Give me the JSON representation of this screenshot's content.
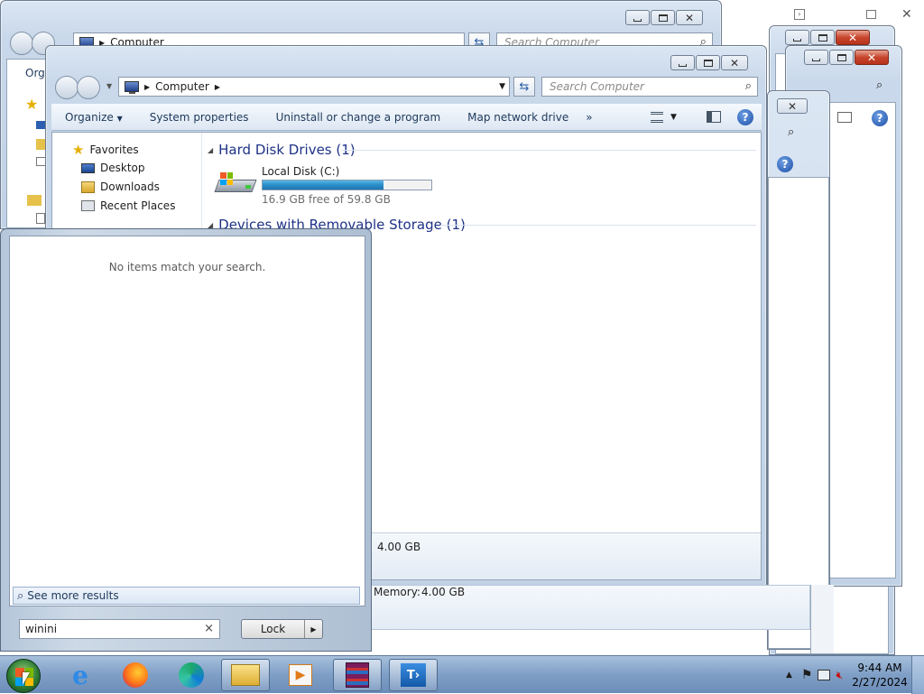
{
  "colors": {
    "accent": "#1e3287",
    "drive_fill": "#2b8dc8",
    "close_red": "#c7452c"
  },
  "back_window_1": {
    "address_text": "Computer",
    "search_placeholder": "Search Computer",
    "toolbar_partial": "Orga"
  },
  "explorer": {
    "address": {
      "location": "Computer"
    },
    "search_placeholder": "Search Computer",
    "toolbar": {
      "organize": "Organize",
      "system_properties": "System properties",
      "uninstall": "Uninstall or change a program",
      "map_drive": "Map network drive",
      "more": "»"
    },
    "nav": {
      "favorites": "Favorites",
      "desktop": "Desktop",
      "downloads": "Downloads",
      "recent_places": "Recent Places"
    },
    "groups": {
      "hard_disk": "Hard Disk Drives (1)",
      "removable": "Devices with Removable Storage (1)"
    },
    "drive": {
      "name": "Local Disk (C:)",
      "free_text": "16.9 GB free of 59.8 GB",
      "used_fraction": 0.717
    },
    "details_memory": "4.00 GB"
  },
  "back_details": {
    "memory_label": "Memory:",
    "memory_value": "4.00 GB"
  },
  "start_menu": {
    "no_items": "No items match your search.",
    "see_more": "See more results",
    "search_value": "winini",
    "lock_label": "Lock"
  },
  "taskbar": {
    "items": [
      "internet-explorer",
      "firefox",
      "edge",
      "explorer",
      "media-player",
      "winrar",
      "remote-desktop"
    ],
    "time": "9:44 AM",
    "date": "2/27/2024"
  }
}
